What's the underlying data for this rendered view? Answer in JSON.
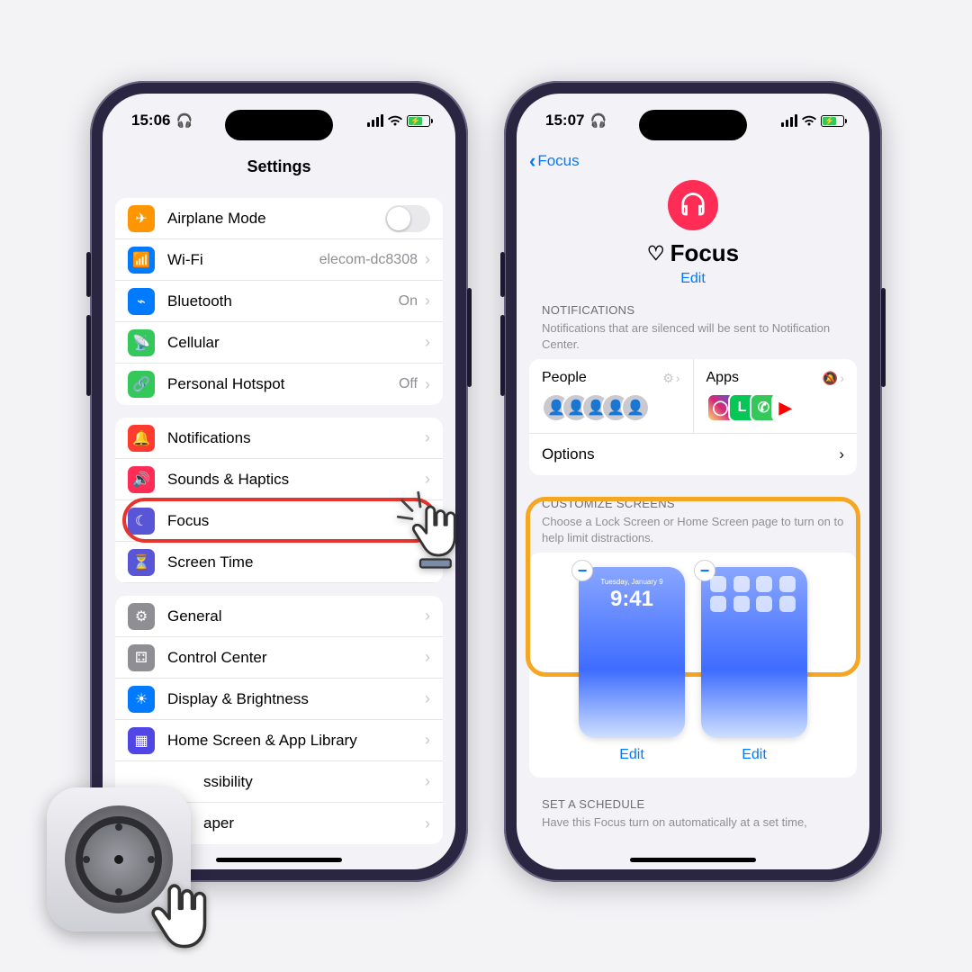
{
  "left": {
    "time": "15:06",
    "title": "Settings",
    "groups": [
      [
        {
          "icon": "airplane",
          "bg": "#ff9500",
          "label": "Airplane Mode",
          "toggle": true
        },
        {
          "icon": "wifi",
          "bg": "#007aff",
          "label": "Wi-Fi",
          "value": "elecom-dc8308"
        },
        {
          "icon": "bluetooth",
          "bg": "#007aff",
          "label": "Bluetooth",
          "value": "On"
        },
        {
          "icon": "cellular",
          "bg": "#34c759",
          "label": "Cellular"
        },
        {
          "icon": "hotspot",
          "bg": "#34c759",
          "label": "Personal Hotspot",
          "value": "Off"
        }
      ],
      [
        {
          "icon": "bell",
          "bg": "#ff3b30",
          "label": "Notifications"
        },
        {
          "icon": "speaker",
          "bg": "#ff2d55",
          "label": "Sounds & Haptics"
        },
        {
          "icon": "moon",
          "bg": "#5856d6",
          "label": "Focus"
        },
        {
          "icon": "hourglass",
          "bg": "#5856d6",
          "label": "Screen Time"
        }
      ],
      [
        {
          "icon": "gear",
          "bg": "#8e8e93",
          "label": "General"
        },
        {
          "icon": "switches",
          "bg": "#8e8e93",
          "label": "Control Center"
        },
        {
          "icon": "sun",
          "bg": "#007aff",
          "label": "Display & Brightness"
        },
        {
          "icon": "grid",
          "bg": "#4f46e5",
          "label": "Home Screen & App Library"
        },
        {
          "icon": "person",
          "bg": "#007aff",
          "label": "Accessibility",
          "partial": true
        },
        {
          "icon": "flower",
          "bg": "#28beca",
          "label": "Wallpaper",
          "partial": true
        }
      ]
    ]
  },
  "right": {
    "time": "15:07",
    "back": "Focus",
    "title": "Focus",
    "edit": "Edit",
    "notif": {
      "header": "NOTIFICATIONS",
      "desc": "Notifications that are silenced will be sent to Notification Center.",
      "people": "People",
      "apps": "Apps",
      "options": "Options"
    },
    "customize": {
      "header": "CUSTOMIZE SCREENS",
      "desc": "Choose a Lock Screen or Home Screen page to turn on to help limit distractions.",
      "edit": "Edit",
      "lock_time": "9:41",
      "lock_date": "Tuesday, January 9"
    },
    "schedule": {
      "header": "SET A SCHEDULE",
      "desc": "Have this Focus turn on automatically at a set time,"
    }
  }
}
